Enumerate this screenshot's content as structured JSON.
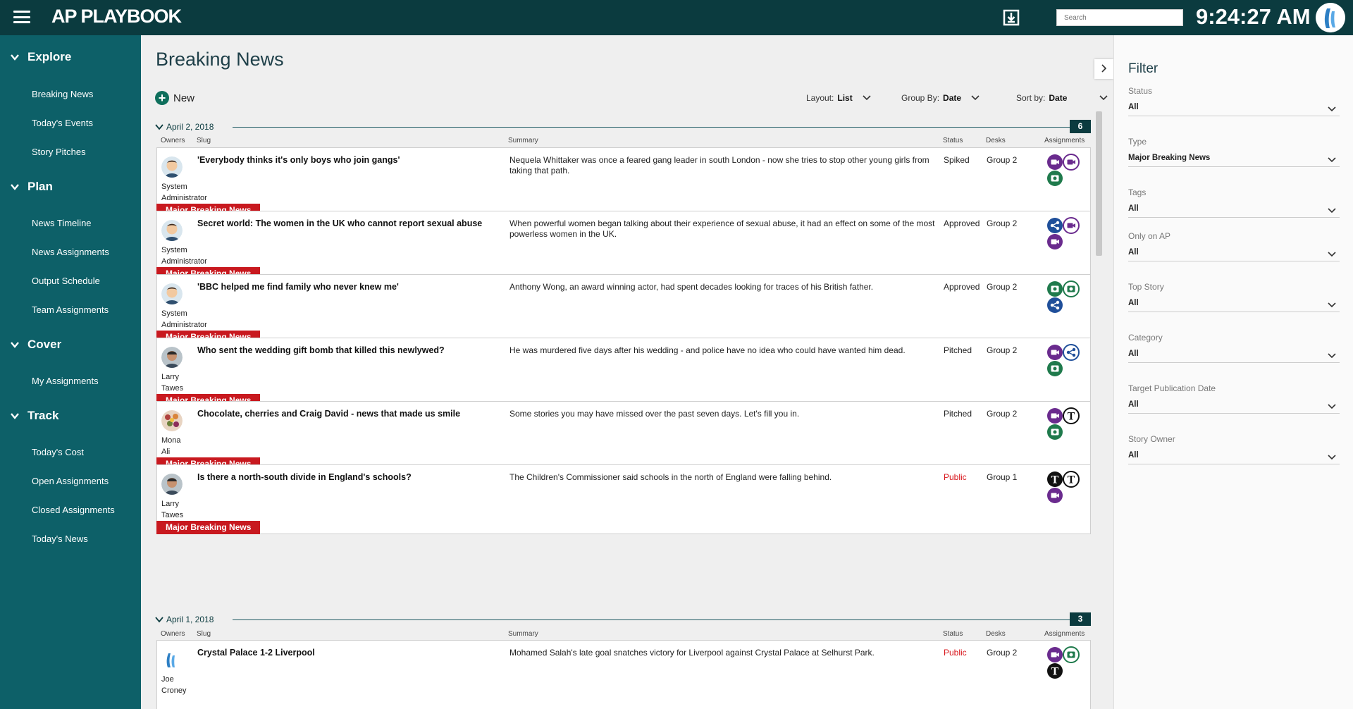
{
  "app": {
    "brand": "AP PLAYBOOK",
    "search_placeholder": "Search",
    "clock": "9:24:27 AM"
  },
  "sidebar": {
    "sections": [
      {
        "title": "Explore",
        "items": [
          "Breaking News",
          "Today's Events",
          "Story Pitches"
        ]
      },
      {
        "title": "Plan",
        "items": [
          "News Timeline",
          "News Assignments",
          "Output Schedule",
          "Team Assignments"
        ]
      },
      {
        "title": "Cover",
        "items": [
          "My Assignments"
        ]
      },
      {
        "title": "Track",
        "items": [
          "Today's Cost",
          "Open Assignments",
          "Closed Assignments",
          "Today's News"
        ]
      }
    ]
  },
  "main": {
    "title": "Breaking News",
    "new_label": "New",
    "layout_label": "Layout:",
    "layout_value": "List",
    "group_label": "Group By:",
    "group_value": "Date",
    "sort_label": "Sort by:",
    "sort_value": "Date",
    "columns": {
      "owners": "Owners",
      "slug": "Slug",
      "summary": "Summary",
      "status": "Status",
      "desks": "Desks",
      "assignments": "Assignments"
    },
    "groups": [
      {
        "date": "April 2, 2018",
        "count": "6",
        "rows": [
          {
            "owner1": "System",
            "owner2": "Administrator",
            "slug": "'Everybody thinks it's only boys who join gangs'",
            "summary": "Nequela Whittaker was once a feared gang leader in south London - now she tries to stop other young girls from taking that path.",
            "status": "Spiked",
            "desk": "Group 2",
            "tag": "Major Breaking News",
            "icons": [
              "video",
              "video-outline",
              "photo"
            ]
          },
          {
            "owner1": "System",
            "owner2": "Administrator",
            "slug": "Secret world: The women in the UK who cannot report sexual abuse",
            "summary": "When powerful women began talking about their experience of sexual abuse, it had an effect on some of the most powerless women in the UK.",
            "status": "Approved",
            "desk": "Group 2",
            "tag": "Major Breaking News",
            "icons": [
              "share",
              "video-outline",
              "video"
            ]
          },
          {
            "owner1": "System",
            "owner2": "Administrator",
            "slug": "'BBC helped me find family who never knew me'",
            "summary": "Anthony Wong, an award winning actor, had spent decades looking for traces of his British father.",
            "status": "Approved",
            "desk": "Group 2",
            "tag": "Major Breaking News",
            "icons": [
              "photo",
              "photo-outline",
              "share"
            ]
          },
          {
            "owner1": "Larry",
            "owner2": "Tawes",
            "slug": "Who sent the wedding gift bomb that killed this newlywed?",
            "summary": "He was murdered five days after his wedding - and police have no idea who could have wanted him dead.",
            "status": "Pitched",
            "desk": "Group 2",
            "tag": "Major Breaking News",
            "icons": [
              "video",
              "share-outline",
              "photo"
            ]
          },
          {
            "owner1": "Mona",
            "owner2": "Ali",
            "slug": "Chocolate, cherries and Craig David - news that made us smile",
            "summary": "Some stories you may have missed over the past seven days. Let's fill you in.",
            "status": "Pitched",
            "desk": "Group 2",
            "tag": "Major Breaking News",
            "icons": [
              "video",
              "text-outline",
              "photo"
            ]
          },
          {
            "owner1": "Larry",
            "owner2": "Tawes",
            "slug": "Is there a north-south divide in England's schools?",
            "summary": "The Children's Commissioner said schools in the north of England were falling behind.",
            "status": "Public",
            "desk": "Group 1",
            "tag": "Major Breaking News",
            "icons": [
              "text",
              "text-outline",
              "video"
            ]
          }
        ]
      },
      {
        "date": "April 1, 2018",
        "count": "3",
        "rows": [
          {
            "owner1": "Joe",
            "owner2": "Croney",
            "slug": "Crystal Palace 1-2 Liverpool",
            "summary": "Mohamed Salah's late goal snatches victory for Liverpool against Crystal Palace at Selhurst Park.",
            "status": "Public",
            "desk": "Group 2",
            "icons": [
              "video",
              "photo-outline",
              "text"
            ]
          }
        ]
      }
    ]
  },
  "filter": {
    "title": "Filter",
    "fields": [
      {
        "label": "Status",
        "value": "All"
      },
      {
        "label": "Type",
        "value": "Major Breaking News"
      },
      {
        "label": "Tags",
        "value": "All"
      },
      {
        "label": "Only on AP",
        "value": "All"
      },
      {
        "label": "Top Story",
        "value": "All"
      },
      {
        "label": "Category",
        "value": "All"
      },
      {
        "label": "Target Publication Date",
        "value": "All"
      },
      {
        "label": "Story Owner",
        "value": "All"
      }
    ]
  },
  "colors": {
    "topbar": "#0b3b3f",
    "sidebar": "#0d6068",
    "tag_red": "#c8191f",
    "video": "#6a2b8e",
    "photo": "#1f7a4c",
    "share": "#1f4f9a",
    "public": "#d8141a"
  }
}
